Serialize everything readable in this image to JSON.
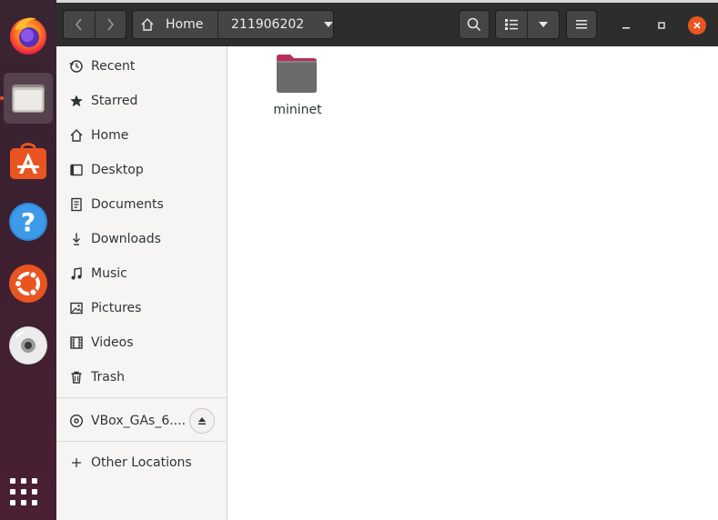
{
  "dock": {
    "apps": [
      {
        "name": "firefox-icon",
        "active": false
      },
      {
        "name": "files-icon",
        "active": true
      },
      {
        "name": "software-center-icon",
        "active": false
      },
      {
        "name": "help-icon",
        "active": false
      },
      {
        "name": "ubuntu-icon",
        "active": false
      },
      {
        "name": "disc-icon",
        "active": false
      }
    ]
  },
  "header": {
    "path_home": "Home",
    "path_current": "211906202"
  },
  "sidebar": {
    "items": [
      {
        "label": "Recent",
        "icon": "clock-icon"
      },
      {
        "label": "Starred",
        "icon": "star-icon"
      },
      {
        "label": "Home",
        "icon": "home-icon"
      },
      {
        "label": "Desktop",
        "icon": "desktop-icon"
      },
      {
        "label": "Documents",
        "icon": "document-icon"
      },
      {
        "label": "Downloads",
        "icon": "download-icon"
      },
      {
        "label": "Music",
        "icon": "music-icon"
      },
      {
        "label": "Pictures",
        "icon": "picture-icon"
      },
      {
        "label": "Videos",
        "icon": "video-icon"
      },
      {
        "label": "Trash",
        "icon": "trash-icon"
      }
    ],
    "device": {
      "label": "VBox_GAs_6....",
      "icon": "disc-drive-icon"
    },
    "other": {
      "label": "Other Locations",
      "icon": "plus-icon"
    }
  },
  "files": [
    {
      "name": "mininet",
      "type": "folder"
    }
  ],
  "colors": {
    "accent": "#e95420",
    "headerbar": "#2d2d2d",
    "sidebar": "#f6f5f4",
    "folder": "#6b6b6b",
    "folder_tab": "#b8305a"
  }
}
